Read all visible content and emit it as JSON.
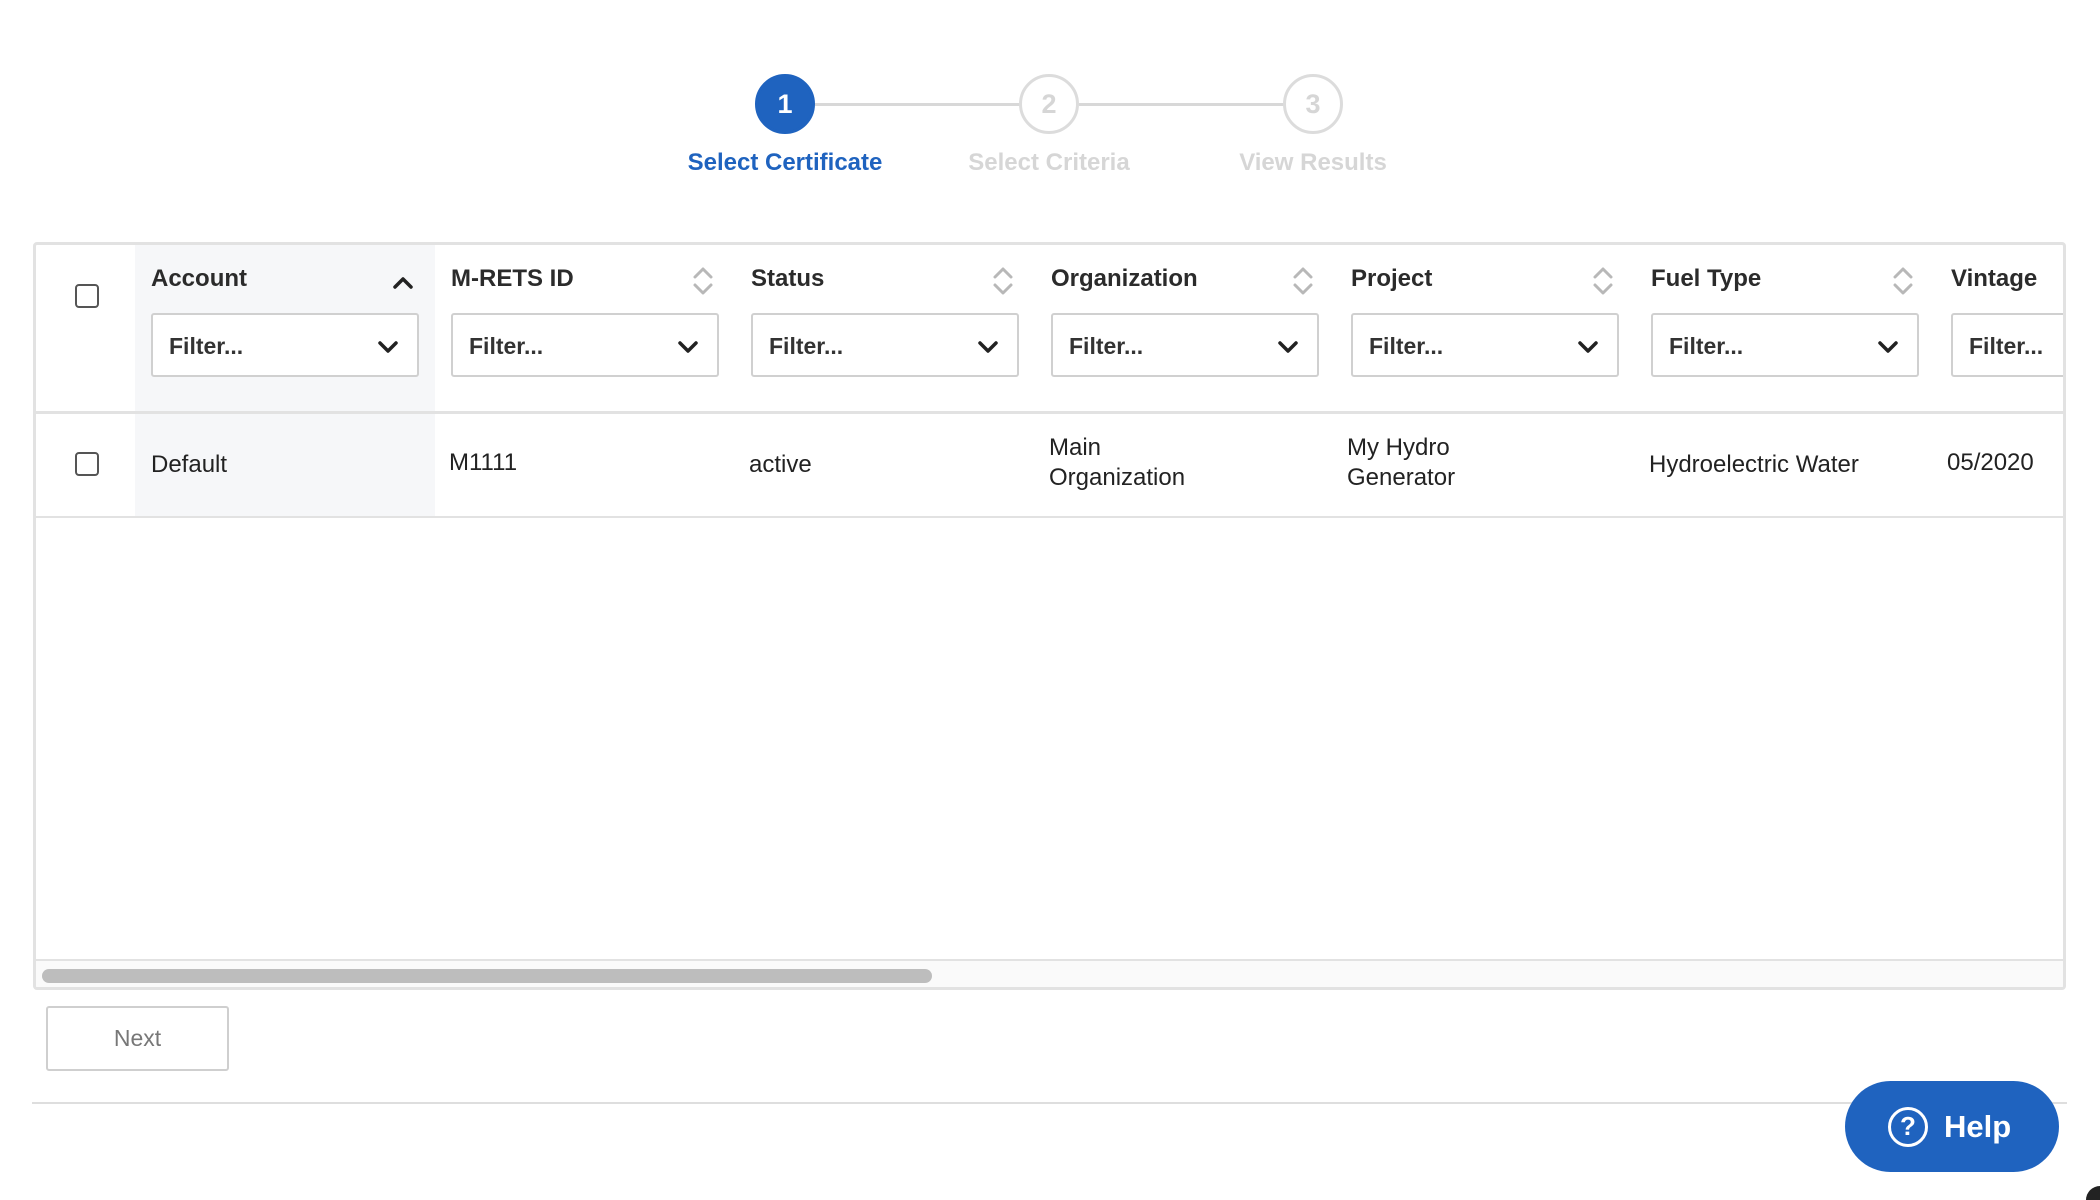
{
  "stepper": {
    "steps": [
      {
        "number": "1",
        "label": "Select Certificate",
        "state": "active"
      },
      {
        "number": "2",
        "label": "Select Criteria",
        "state": "inactive"
      },
      {
        "number": "3",
        "label": "View Results",
        "state": "inactive"
      }
    ]
  },
  "table": {
    "columns": [
      {
        "title": "Account",
        "sort": "ascending",
        "filter_placeholder": "Filter..."
      },
      {
        "title": "M-RETS ID",
        "sort": "none",
        "filter_placeholder": "Filter..."
      },
      {
        "title": "Status",
        "sort": "none",
        "filter_placeholder": "Filter..."
      },
      {
        "title": "Organization",
        "sort": "none",
        "filter_placeholder": "Filter..."
      },
      {
        "title": "Project",
        "sort": "none",
        "filter_placeholder": "Filter..."
      },
      {
        "title": "Fuel Type",
        "sort": "none",
        "filter_placeholder": "Filter..."
      },
      {
        "title": "Vintage",
        "sort": "none",
        "filter_placeholder": "Filter..."
      }
    ],
    "rows": [
      {
        "checked": false,
        "account": "Default",
        "mrets_id": "M1111",
        "status": "active",
        "organization_line1": "Main",
        "organization_line2": "Organization",
        "project_line1": "My Hydro",
        "project_line2": "Generator",
        "fuel_type": "Hydroelectric Water",
        "vintage": "05/2020"
      }
    ]
  },
  "footer": {
    "next_label": "Next",
    "help_label": "Help",
    "help_icon_glyph": "?"
  },
  "colors": {
    "accent": "#1f63bf",
    "inactive_step": "#d6d6d6",
    "border": "#e2e2e2"
  }
}
